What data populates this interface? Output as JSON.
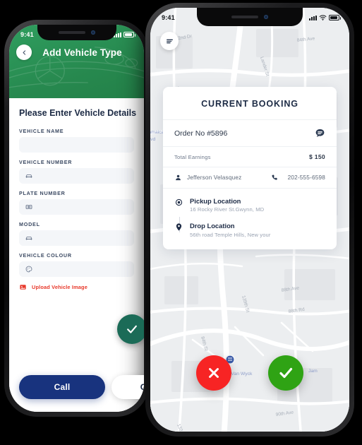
{
  "left_phone": {
    "status_bar": {
      "time": "9:41"
    },
    "header": {
      "back_icon": "chevron-left-icon",
      "title": "Add Vehicle Type",
      "background_color": "#2f9e5f",
      "artwork": "mercedes-car-watermark"
    },
    "form": {
      "title": "Please Enter Vehicle Details",
      "fields": [
        {
          "label": "VEHICLE  NAME",
          "value": "",
          "icon": ""
        },
        {
          "label": "VEHICLE  NUMBER",
          "value": "",
          "icon": "car-icon"
        },
        {
          "label": "PLATE NUMBER",
          "value": "",
          "icon": "license-plate-icon"
        },
        {
          "label": "MODEL",
          "value": "",
          "icon": "car-icon"
        },
        {
          "label": "VEHICLE COLOUR",
          "value": "",
          "icon": "color-palette-icon"
        }
      ],
      "upload": {
        "label": "Upload Vehicle Image",
        "icon": "image-icon",
        "color": "#e8392b"
      }
    },
    "fab": {
      "icon": "check-icon",
      "color": "#1b6b57"
    },
    "buttons": [
      {
        "label": "Call",
        "style": "primary",
        "color": "#18337e"
      },
      {
        "label": "Cancel",
        "style": "ghost"
      }
    ]
  },
  "right_phone": {
    "status_bar": {
      "time": "9:41",
      "signal_icon": "signal-icon",
      "wifi_icon": "wifi-icon",
      "battery_icon": "battery-icon"
    },
    "menu_button": {
      "icon": "hamburger-menu-icon"
    },
    "booking": {
      "title": "CURRENT BOOKING",
      "order_number": "Order No #5896",
      "chat_icon": "chat-bubble-icon",
      "earnings_label": "Total Earnings",
      "earnings_value": "$ 150",
      "customer_icon": "person-icon",
      "customer_name": "Jefferson Velasquez",
      "phone_icon": "phone-icon",
      "customer_phone": "202-555-6598",
      "pickup": {
        "icon": "target-pin-icon",
        "title": "Pickup Location",
        "address": "16 Rocky River St.Gwynn, MD"
      },
      "drop": {
        "icon": "map-pin-icon",
        "title": "Drop Location",
        "address": "56th road Temple Hills, New your"
      }
    },
    "actions": {
      "reject": {
        "icon": "close-x-icon",
        "color": "#f72424"
      },
      "accept": {
        "icon": "check-icon",
        "color": "#2fa314"
      }
    },
    "map": {
      "labels": [
        "82nd Dr",
        "84th Ave",
        "Lander St",
        "139th St",
        "87th Ave",
        "88th Ave",
        "88th Rd",
        "90th Ave",
        "139th St",
        "132"
      ],
      "transit_label": "Jamaica – Van Wyck",
      "transit_label_left": "Jamaica – Van Wyck Blvd"
    }
  }
}
